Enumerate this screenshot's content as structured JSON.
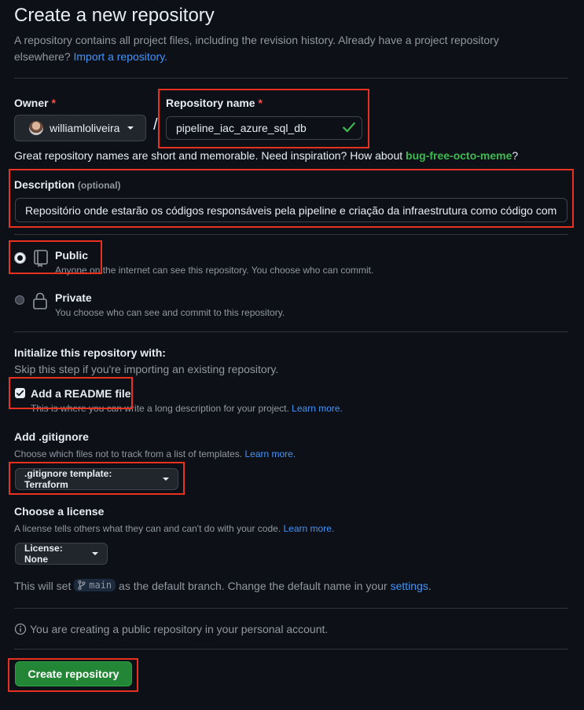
{
  "header": {
    "title": "Create a new repository",
    "subtitle_text": "A repository contains all project files, including the revision history. Already have a project repository elsewhere?",
    "import_link": "Import a repository."
  },
  "owner": {
    "label": "Owner",
    "required_mark": "*",
    "value": "williamloliveira",
    "slash": "/"
  },
  "repo_name": {
    "label": "Repository name",
    "required_mark": "*",
    "value": "pipeline_iac_azure_sql_db"
  },
  "name_hint": {
    "text": "Great repository names are short and memorable. Need inspiration? How about",
    "suggestion": "bug-free-octo-meme",
    "end": "?"
  },
  "description": {
    "label": "Description",
    "optional": "(optional)",
    "value": "Repositório onde estarão os códigos responsáveis pela pipeline e criação da infraestrutura como código com terraform"
  },
  "visibility": {
    "public": {
      "title": "Public",
      "desc": "Anyone on the internet can see this repository. You choose who can commit.",
      "selected": true
    },
    "private": {
      "title": "Private",
      "desc": "You choose who can see and commit to this repository.",
      "selected": false
    }
  },
  "init": {
    "heading": "Initialize this repository with:",
    "skip": "Skip this step if you're importing an existing repository.",
    "readme_label": "Add a README file",
    "readme_checked": true,
    "readme_desc": "This is where you can write a long description for your project.",
    "readme_link": "Learn more."
  },
  "gitignore": {
    "heading": "Add .gitignore",
    "desc": "Choose which files not to track from a list of templates.",
    "link": "Learn more.",
    "button": ".gitignore template: Terraform"
  },
  "license": {
    "heading": "Choose a license",
    "desc": "A license tells others what they can and can't do with your code.",
    "link": "Learn more.",
    "button": "License: None"
  },
  "branch_note": {
    "pre": "This will set",
    "branch": "main",
    "mid": "as the default branch. Change the default name in your",
    "link": "settings",
    "end": "."
  },
  "notice": {
    "text": "You are creating a public repository in your personal account."
  },
  "submit": {
    "label": "Create repository"
  },
  "colors": {
    "background": "#0d1117",
    "primary_button": "#238636",
    "link": "#4493f8",
    "annotation": "#e8321f"
  }
}
